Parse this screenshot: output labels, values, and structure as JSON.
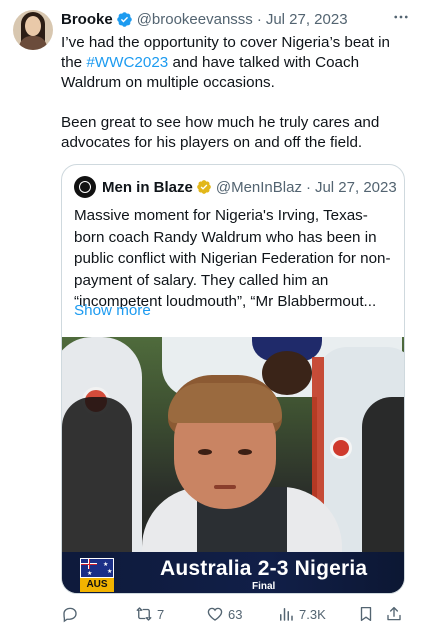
{
  "author": {
    "name": "Brooke",
    "handle": "@brookeevansss",
    "date": "Jul 27, 2023",
    "separator": "·"
  },
  "tweet": {
    "line1_prefix": "I’ve had the opportunity to cover Nigeria’s beat in the ",
    "hashtag": "#WWC2023",
    "line1_suffix": " and have talked with Coach Waldrum on multiple occasions.",
    "para2": "Been great to see how much he truly cares and advocates for his players on and off the field."
  },
  "quoted": {
    "name": "Men in Blaze",
    "handle": "@MenInBlaz",
    "date": "Jul 27, 2023",
    "separator": "·",
    "text": "Massive moment for Nigeria's Irving, Texas-born coach Randy Waldrum who has been in public conflict with Nigerian Federation for non-payment of salary. They called him an “incompetent loudmouth”, “Mr Blabbermout...",
    "show_more": "Show more",
    "media": {
      "score_text": "Australia  2-3  Nigeria",
      "status": "Final",
      "team_badge": "AUS"
    }
  },
  "actions": {
    "reply_count": "",
    "retweet_count": "7",
    "like_count": "63",
    "views_count": "7.3K"
  },
  "colors": {
    "accent": "#1d9bf0",
    "secondary_text": "#536471",
    "border": "#cfd9de",
    "scorebar": "#0e1a3b"
  },
  "icons": [
    "verified-badge-icon",
    "gold-verified-badge-icon",
    "more-icon",
    "reply-icon",
    "retweet-icon",
    "like-icon",
    "views-icon",
    "bookmark-icon",
    "share-icon"
  ]
}
